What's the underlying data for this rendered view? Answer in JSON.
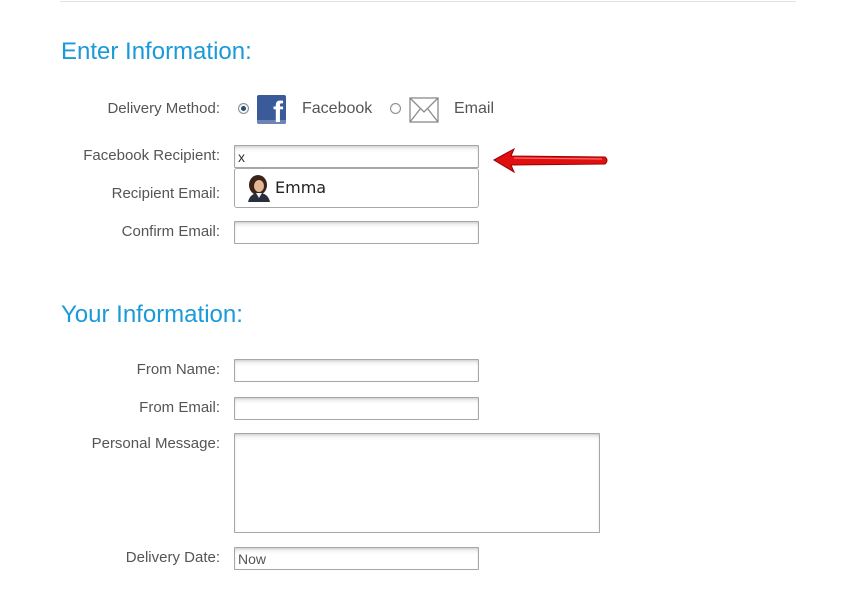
{
  "enter_section": {
    "title": "Enter Information:",
    "delivery_method": {
      "label": "Delivery Method:",
      "options": [
        {
          "label": "Facebook",
          "icon": "facebook-icon",
          "selected": true
        },
        {
          "label": "Email",
          "icon": "envelope-icon",
          "selected": false
        }
      ]
    },
    "facebook_recipient": {
      "label": "Facebook Recipient:",
      "value": "x"
    },
    "suggestion": {
      "name": "Emma",
      "icon": "user-avatar-icon"
    },
    "recipient_email": {
      "label": "Recipient Email:",
      "value": ""
    },
    "confirm_email": {
      "label": "Confirm Email:",
      "value": ""
    }
  },
  "your_section": {
    "title": "Your Information:",
    "from_name": {
      "label": "From Name:",
      "value": ""
    },
    "from_email": {
      "label": "From Email:",
      "value": ""
    },
    "personal_message": {
      "label": "Personal Message:",
      "value": ""
    },
    "delivery_date": {
      "label": "Delivery Date:",
      "value": "Now"
    }
  },
  "colors": {
    "heading": "#1a9ad9",
    "facebook_blue": "#3b5a9a",
    "annotation_arrow": "#e01010"
  }
}
